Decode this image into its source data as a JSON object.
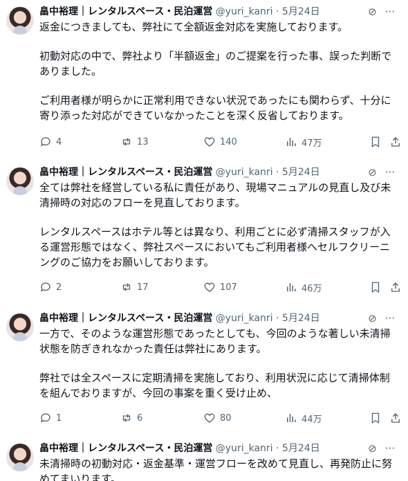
{
  "tweets": [
    {
      "author": "畠中裕理｜レンタルスペース・民泊運営",
      "handle": "@yuri_kanri",
      "date": "5月24日",
      "paragraphs": [
        "返金につきましても、弊社にて全額返金対応を実施しております。",
        "初動対応の中で、弊社より「半額返金」のご提案を行った事、誤った判断で\nありました。",
        "ご利用者様が明らかに正常利用できない状況であったにも関わらず、十分に\n寄り添った対応ができていなかったことを深く反省しております。"
      ],
      "replies": "4",
      "retweets": "13",
      "likes": "140",
      "views": "47万"
    },
    {
      "author": "畠中裕理｜レンタルスペース・民泊運営",
      "handle": "@yuri_kanri",
      "date": "5月24日",
      "paragraphs": [
        "全ては弊社を経営している私に責任があり、現場マニュアルの見直し及び未\n清掃時の対応のフローを見直しております。",
        "レンタルスペースはホテル等とは異なり、利用ごとに必ず清掃スタッフが入\nる運営形態ではなく、弊社スペースにおいてもご利用者様へセルフクリーニ\nングのご協力をお願いしております。"
      ],
      "replies": "2",
      "retweets": "17",
      "likes": "107",
      "views": "46万"
    },
    {
      "author": "畠中裕理｜レンタルスペース・民泊運営",
      "handle": "@yuri_kanri",
      "date": "5月24日",
      "paragraphs": [
        "一方で、そのような運営形態であったとしても、今回のような著しい未清掃\n状態を防ぎきれなかった責任は弊社にあります。",
        "弊社では全スペースに定期清掃を実施しており、利用状況に応じて清掃体制\nを組んでおりますが、今回の事案を重く受け止め、"
      ],
      "replies": "1",
      "retweets": "6",
      "likes": "80",
      "views": "44万"
    },
    {
      "author": "畠中裕理｜レンタルスペース・民泊運営",
      "handle": "@yuri_kanri",
      "date": "5月24日",
      "paragraphs": [
        "未清掃時の初動対応・返金基準・運営フローを改めて見直し、再発防止に努\nめてまいります。"
      ]
    }
  ]
}
